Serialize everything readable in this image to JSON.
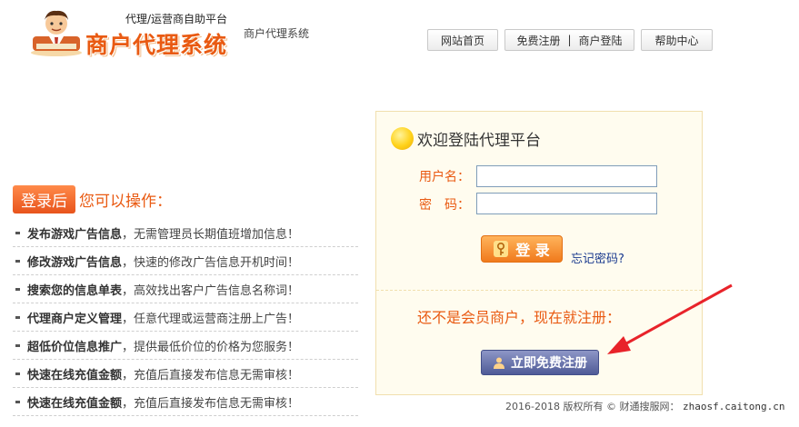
{
  "header": {
    "tagline": "代理/运营商自助平台",
    "brand": "商户代理系统",
    "brand_sub": "商户代理系统",
    "mascot_icon": "businessman-mascot-icon"
  },
  "topnav": {
    "home": "网站首页",
    "register": "免费注册",
    "separator": "|",
    "login": "商户登陆",
    "help": "帮助中心"
  },
  "ops": {
    "badge": "登录后",
    "title": "您可以操作：",
    "items": [
      {
        "strong": "发布游戏广告信息",
        "text": "，无需管理员长期值班增加信息！"
      },
      {
        "strong": "修改游戏广告信息",
        "text": "，快速的修改广告信息开机时间！"
      },
      {
        "strong": "搜索您的信息单表",
        "text": "，高效找出客户广告信息名称词！"
      },
      {
        "strong": "代理商户定义管理",
        "text": "，任意代理或运营商注册上广告！"
      },
      {
        "strong": "超低价位信息推广",
        "text": "，提供最低价位的价格为您服务！"
      },
      {
        "strong": "快速在线充值金额",
        "text": "，充值后直接发布信息无需审核！"
      },
      {
        "strong": "快速在线充值金额",
        "text": "，充值后直接发布信息无需审核！"
      }
    ]
  },
  "login": {
    "title": "欢迎登陆代理平台",
    "username_label": "用户名：",
    "password_label": "密　码：",
    "username_value": "",
    "password_value": "",
    "login_button": "登 录",
    "forgot_link": "忘记密码?",
    "register_prompt": "还不是会员商户，现在就注册：",
    "register_button": "立即免费注册"
  },
  "footer": {
    "copyright": "2016-2018  版权所有  ©  财通搜服网：",
    "site": "zhaosf.caitong.cn"
  },
  "colors": {
    "accent": "#e95a12",
    "panel_bg": "#fffcef",
    "panel_border": "#f1dfae",
    "register_button": "#4f5b97",
    "arrow": "#e8232a"
  }
}
